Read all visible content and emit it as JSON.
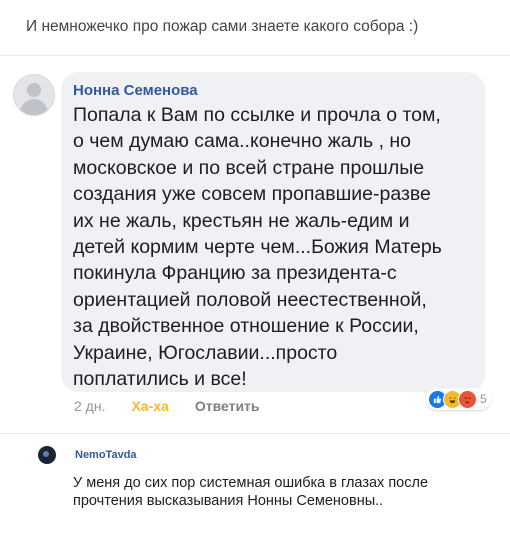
{
  "post": {
    "intro_text": "И немножечко про пожар сами знаете какого собора :)"
  },
  "comment": {
    "author": "Нонна Семенова",
    "text": "Попала к Вам по ссылке и прочла  о том,\nо чем думаю сама..конечно жаль , но\nмосковское  и по всей стране прошлые\nсоздания  уже совсем пропавшие-разве\nих не жаль, крестьян не жаль-едим и\nдетей кормим черте чем...Божия Матерь\nпокинула Францию за президента-с\nориентацией  половой неестественной,\nза двойственное отношение к России,\nУкраине, Югославии...просто\nпоплатились и все!",
    "time": "2 дн.",
    "reaction_label": "Ха-ха",
    "reply_label": "Ответить",
    "reactions": {
      "icons": [
        "like-icon",
        "haha-icon",
        "angry-icon"
      ],
      "count": "5",
      "colors": {
        "like": "#1877f2",
        "haha": "#f7b928",
        "angry": "#e9543c"
      }
    }
  },
  "reply": {
    "author": "NemoTavda",
    "text": "У меня до сих пор системная ошибка в глазах после\nпрочтения высказывания Нонны Семеновны.."
  }
}
